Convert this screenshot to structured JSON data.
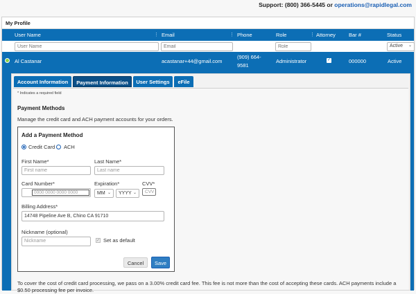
{
  "support": {
    "label": "Support: (800) 366-5445 or",
    "email": "operations@rapidlegal.com"
  },
  "profile": {
    "title": "My Profile"
  },
  "grid": {
    "columns": [
      "User Name",
      "Email",
      "Phone",
      "Role",
      "Attorney",
      "Bar #",
      "Status"
    ],
    "filters": {
      "username_placeholder": "User Name",
      "email_placeholder": "Email",
      "role_placeholder": "Role",
      "status_value": "Active"
    },
    "row": {
      "user_name": "Al Castanar",
      "email": "acastanar+44@gmail.com",
      "phone_line1": "(909) 664-",
      "phone_line2": "9581",
      "role": "Administrator",
      "attorney_checked": true,
      "bar_number": "000000",
      "status": "Active"
    }
  },
  "tabs": [
    {
      "label": "Account Information",
      "active": false
    },
    {
      "label": "Payment Information",
      "active": true
    },
    {
      "label": "User Settings",
      "active": false
    },
    {
      "label": "eFile",
      "active": false
    }
  ],
  "payment": {
    "required_note": "* Indicates a required field",
    "title": "Payment Methods",
    "description": "Manage the credit card and ACH payment accounts for your orders.",
    "add_box": {
      "title": "Add a Payment Method",
      "radio_credit_card": "Credit Card",
      "radio_ach": "ACH",
      "first_name_label": "First Name*",
      "first_name_placeholder": "First name",
      "last_name_label": "Last Name*",
      "last_name_placeholder": "Last name",
      "card_number_label": "Card Number*",
      "card_number_placeholder": "0000 0000 0000 0000",
      "expiration_label": "Expiration*",
      "month_placeholder": "MM",
      "year_placeholder": "YYYY",
      "cvv_label": "CVV*",
      "cvv_placeholder": "CVV",
      "billing_label": "Billing Address*",
      "billing_value": "14748 Pipeline Ave B, Chino CA 91710",
      "nickname_label": "Nickname (optional)",
      "nickname_placeholder": "Nickname",
      "default_label": "Set as default",
      "cancel_label": "Cancel",
      "save_label": "Save"
    },
    "fee_note": "To cover the cost of credit card processing, we pass on a 3.00% credit card fee. This fee is not more than the cost of accepting these cards. ACH payments include a $0.50 processing fee per invoice."
  },
  "colors": {
    "header_blue": "#0c6eb5",
    "active_tab": "#0b4f87",
    "save_button": "#2f7ec2",
    "link": "#1a5fb4"
  }
}
